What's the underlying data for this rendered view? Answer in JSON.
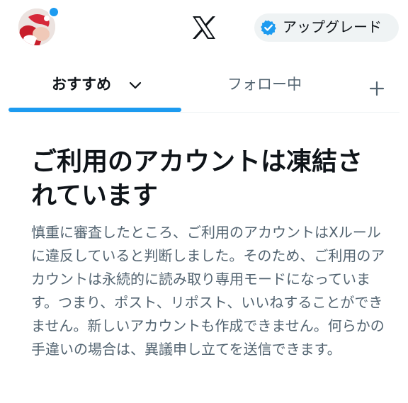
{
  "header": {
    "avatar_alt": "profile avatar",
    "logo_icon": "x-logo-icon",
    "upgrade": {
      "label": "アップグレード",
      "icon": "verified-badge-icon"
    },
    "notification_dot_color": "#1d9bf0"
  },
  "tabs": {
    "items": [
      {
        "label": "おすすめ",
        "active": true,
        "icon": "chevron-down-icon"
      },
      {
        "label": "フォロー中",
        "active": false
      }
    ],
    "add_icon": "plus-icon",
    "indicator_color": "#1d9bf0"
  },
  "notice": {
    "title": "ご利用のアカウントは凍結されています",
    "body": "慎重に審査したところ、ご利用のアカウントはXルールに違反していると判断しました。そのため、ご利用のアカウントは永続的に読み取り専用モードになっています。つまり、ポスト、リポスト、いいねすることができません。新しいアカウントも作成できません。何らかの手違いの場合は、異議申し立てを送信できます。"
  },
  "colors": {
    "accent": "#1d9bf0",
    "text_primary": "#0f1419",
    "text_secondary": "#536471",
    "button_bg": "#eff3f4"
  }
}
